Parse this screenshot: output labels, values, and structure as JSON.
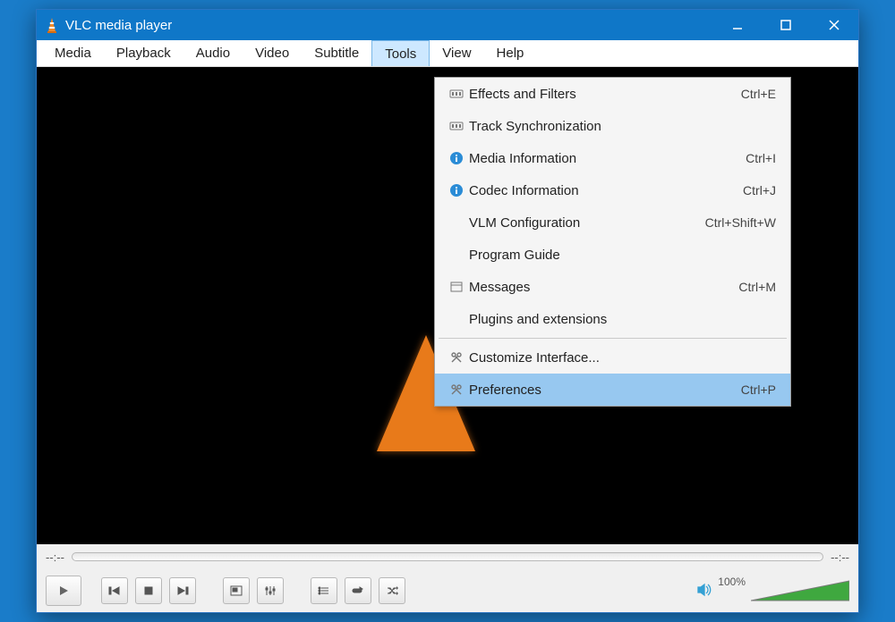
{
  "titlebar": {
    "title": "VLC media player"
  },
  "menubar": {
    "items": [
      "Media",
      "Playback",
      "Audio",
      "Video",
      "Subtitle",
      "Tools",
      "View",
      "Help"
    ],
    "open_index": 5
  },
  "dropdown": {
    "groups": [
      [
        {
          "icon": "equalizer",
          "label": "Effects and Filters",
          "shortcut": "Ctrl+E"
        },
        {
          "icon": "equalizer",
          "label": "Track Synchronization",
          "shortcut": ""
        },
        {
          "icon": "info",
          "label": "Media Information",
          "shortcut": "Ctrl+I"
        },
        {
          "icon": "info",
          "label": "Codec Information",
          "shortcut": "Ctrl+J"
        },
        {
          "icon": "",
          "label": "VLM Configuration",
          "shortcut": "Ctrl+Shift+W"
        },
        {
          "icon": "",
          "label": "Program Guide",
          "shortcut": ""
        },
        {
          "icon": "window",
          "label": "Messages",
          "shortcut": "Ctrl+M"
        },
        {
          "icon": "",
          "label": "Plugins and extensions",
          "shortcut": ""
        }
      ],
      [
        {
          "icon": "tools",
          "label": "Customize Interface...",
          "shortcut": ""
        },
        {
          "icon": "tools",
          "label": "Preferences",
          "shortcut": "Ctrl+P",
          "highlight": true
        }
      ]
    ]
  },
  "seek": {
    "left_time": "--:--",
    "right_time": "--:--"
  },
  "volume": {
    "label": "100%"
  }
}
